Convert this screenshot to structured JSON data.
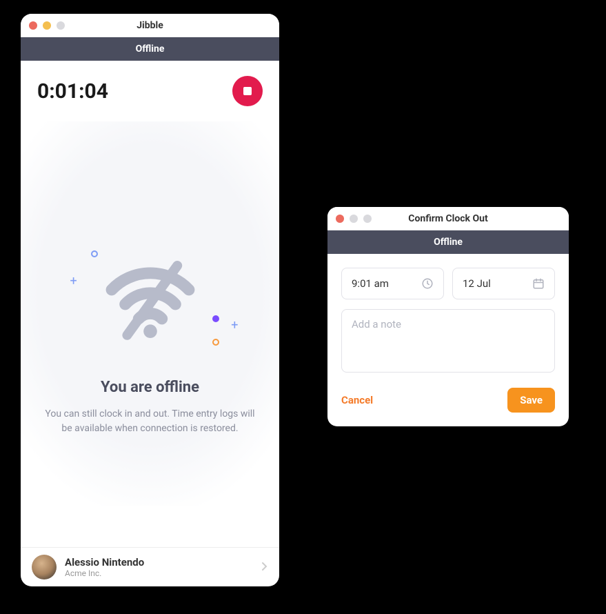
{
  "main": {
    "title": "Jibble",
    "status": "Offline",
    "timer": "0:01:04",
    "offline_heading": "You are offline",
    "offline_body": "You can still clock in and out. Time entry logs will be available when connection is restored.",
    "user": {
      "name": "Alessio Nintendo",
      "org": "Acme Inc."
    }
  },
  "dialog": {
    "title": "Confirm Clock Out",
    "status": "Offline",
    "time_value": "9:01 am",
    "date_value": "12 Jul",
    "note_placeholder": "Add a note",
    "cancel_label": "Cancel",
    "save_label": "Save"
  },
  "colors": {
    "accent": "#f7931e",
    "danger": "#e21b4d",
    "slate": "#4a4d5e"
  }
}
